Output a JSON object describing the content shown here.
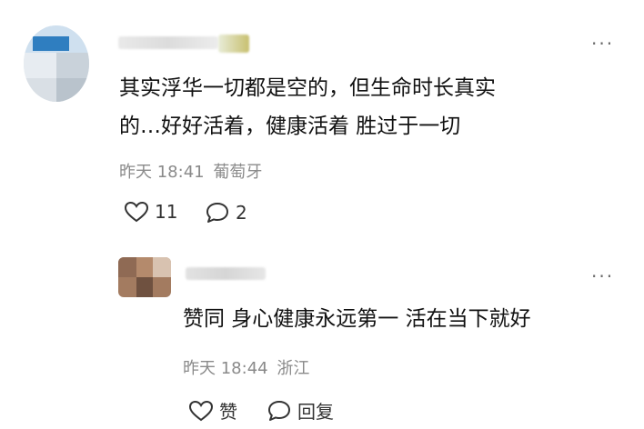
{
  "comment": {
    "more_icon": "···",
    "text_line1": "其实浮华一切都是空的，但生命时长真实",
    "text_line2": "的…好好活着，健康活着 胜过于一切",
    "time": "昨天 18:41",
    "location": "葡萄牙",
    "likes": "11",
    "replies": "2"
  },
  "reply": {
    "more_icon": "···",
    "text": "赞同 身心健康永远第一 活在当下就好",
    "time": "昨天 18:44",
    "location": "浙江",
    "like_label": "赞",
    "reply_label": "回复"
  },
  "icons": {
    "like": "heart-icon",
    "comment": "comment-bubble-icon",
    "more": "more-dots-icon"
  }
}
